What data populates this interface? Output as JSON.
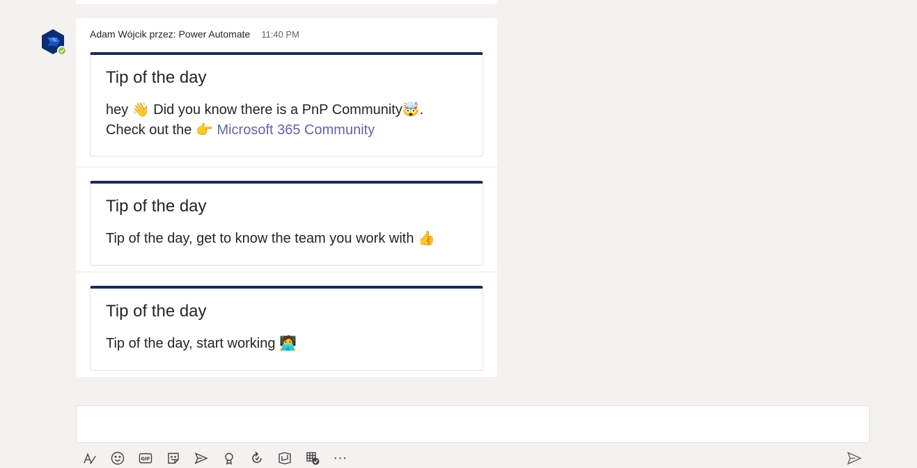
{
  "message": {
    "sender": "Adam Wójcik przez: Power Automate",
    "timestamp": "11:40 PM"
  },
  "cards": [
    {
      "title": "Tip of the day",
      "line1_text": "hey",
      "line1_emoji1": "👋",
      "line1_rest": "Did you know there is a PnP Community",
      "line1_emoji2": "🤯",
      "line1_end": ".",
      "line2_text": "Check out the",
      "line2_emoji": "👉",
      "link": "Microsoft 365 Community"
    },
    {
      "title": "Tip of the day",
      "text": "Tip of the day, get to know the team you work with",
      "emoji": "👍"
    },
    {
      "title": "Tip of the day",
      "text": "Tip of the day, start working",
      "emoji": "🧑‍💻"
    }
  ],
  "colors": {
    "accent": "#6264a7",
    "card_top_border": "#1a2a5a",
    "presence": "#92c353",
    "background": "#f3f2f1"
  },
  "toolbar": {
    "icons": [
      "format-icon",
      "emoji-icon",
      "gif-icon",
      "sticker-icon",
      "meet-now-icon",
      "praise-icon",
      "loop-icon",
      "stream-icon",
      "approvals-icon",
      "more-options-icon",
      "send-icon"
    ],
    "gif_label": "GIF",
    "more_label": "···"
  }
}
